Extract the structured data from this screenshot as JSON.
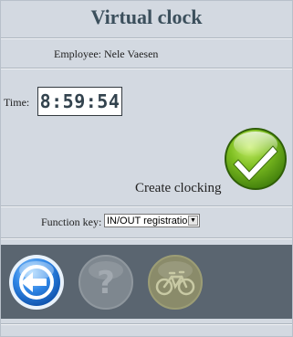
{
  "header": {
    "title": "Virtual clock"
  },
  "employee": {
    "text": "Employee: Nele Vaesen"
  },
  "time": {
    "label": "Time:",
    "value": "8:59:54"
  },
  "clocking": {
    "label": "Create clocking",
    "icon": "checkmark-icon",
    "color": "#6aa51f"
  },
  "function_key": {
    "label": "Function key:",
    "selected": "IN/OUT registration"
  },
  "toolbar": {
    "background": "#5a6570",
    "buttons": [
      {
        "icon": "back-arrow-icon",
        "enabled": true
      },
      {
        "icon": "help-icon",
        "enabled": false
      },
      {
        "icon": "bicycle-icon",
        "enabled": false
      }
    ]
  }
}
